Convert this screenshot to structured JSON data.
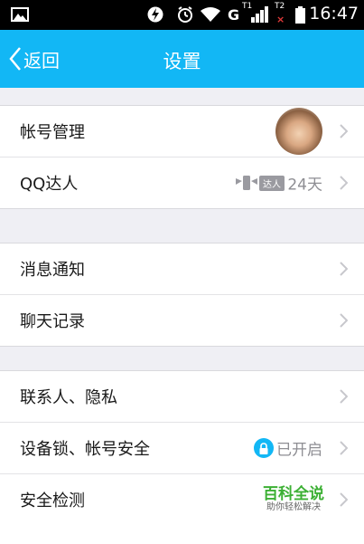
{
  "status_bar": {
    "time": "16:47",
    "network_label": "G",
    "sim1_label": "T1",
    "sim2_label": "T2"
  },
  "nav": {
    "back_label": "返回",
    "title": "设置"
  },
  "sections": [
    {
      "rows": [
        {
          "label": "帐号管理"
        },
        {
          "label": "QQ达人",
          "badge": "达人",
          "value": "24天"
        }
      ]
    },
    {
      "rows": [
        {
          "label": "消息通知"
        },
        {
          "label": "聊天记录"
        }
      ]
    },
    {
      "rows": [
        {
          "label": "联系人、隐私"
        },
        {
          "label": "设备锁、帐号安全",
          "value": "已开启"
        },
        {
          "label": "安全检测",
          "brand": "百科全说",
          "slogan": "助你轻松解决"
        }
      ]
    }
  ],
  "colors": {
    "accent": "#12b7f5",
    "background": "#efeff4",
    "brand_green": "#3cb034"
  }
}
